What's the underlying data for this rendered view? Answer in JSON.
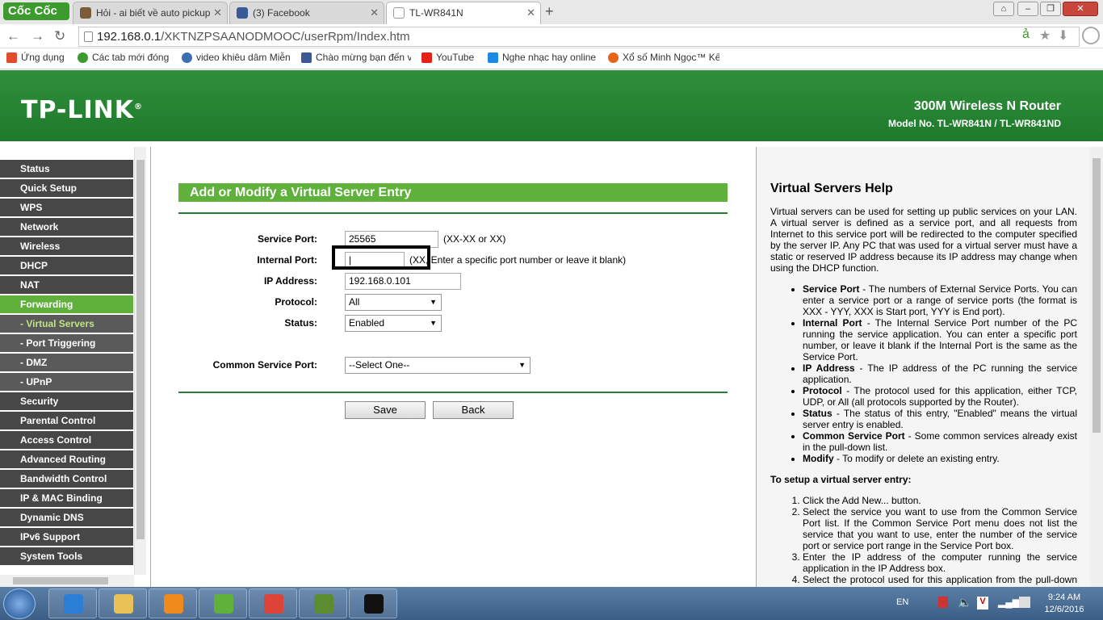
{
  "browser": {
    "logo": "Cốc Cốc",
    "tabs": [
      {
        "title": "Hỏi - ai biết về auto pickup",
        "color": "#7a5a3a"
      },
      {
        "title": "(3) Facebook",
        "color": "#3b5998"
      },
      {
        "title": "TL-WR841N",
        "color": "#ffffff"
      }
    ],
    "url_host": "192.168.0.1",
    "url_path": "/XKTNZPSAANODMOOC/userRpm/Index.htm",
    "bookmarks": [
      {
        "label": "Ứng dụng",
        "color": "#e24b2b"
      },
      {
        "label": "Các tab mới đóng",
        "color": "#3c9a2e"
      },
      {
        "label": "video khiêu dâm Miễn",
        "color": "#3a6fb0"
      },
      {
        "label": "Chào mừng bạn đến v",
        "color": "#3b5998"
      },
      {
        "label": "YouTube",
        "color": "#e62117"
      },
      {
        "label": "Nghe nhạc hay online",
        "color": "#1e88e5"
      },
      {
        "label": "Xổ số Minh Ngọc™ Kế",
        "color": "#e8641b"
      }
    ]
  },
  "router": {
    "brand": "TP-LINK",
    "trademark": "®",
    "title": "300M Wireless N Router",
    "model": "Model No. TL-WR841N / TL-WR841ND"
  },
  "menu": [
    {
      "label": "Status",
      "type": "main"
    },
    {
      "label": "Quick Setup",
      "type": "main"
    },
    {
      "label": "WPS",
      "type": "main"
    },
    {
      "label": "Network",
      "type": "main"
    },
    {
      "label": "Wireless",
      "type": "main"
    },
    {
      "label": "DHCP",
      "type": "main"
    },
    {
      "label": "NAT",
      "type": "main"
    },
    {
      "label": "Forwarding",
      "type": "active"
    },
    {
      "label": "- Virtual Servers",
      "type": "sub-selected"
    },
    {
      "label": "- Port Triggering",
      "type": "sub"
    },
    {
      "label": "- DMZ",
      "type": "sub"
    },
    {
      "label": "- UPnP",
      "type": "sub"
    },
    {
      "label": "Security",
      "type": "main"
    },
    {
      "label": "Parental Control",
      "type": "main"
    },
    {
      "label": "Access Control",
      "type": "main"
    },
    {
      "label": "Advanced Routing",
      "type": "main"
    },
    {
      "label": "Bandwidth Control",
      "type": "main"
    },
    {
      "label": "IP & MAC Binding",
      "type": "main"
    },
    {
      "label": "Dynamic DNS",
      "type": "main"
    },
    {
      "label": "IPv6 Support",
      "type": "main"
    },
    {
      "label": "System Tools",
      "type": "main"
    }
  ],
  "form": {
    "title": "Add or Modify a Virtual Server Entry",
    "service_port_label": "Service Port:",
    "service_port_value": "25565",
    "service_port_hint": "(XX-XX or XX)",
    "internal_port_label": "Internal Port:",
    "internal_port_value": "|",
    "internal_port_hint": "(XX, Enter a specific port number or leave it blank)",
    "ip_label": "IP Address:",
    "ip_value": "192.168.0.101",
    "protocol_label": "Protocol:",
    "protocol_value": "All",
    "status_label": "Status:",
    "status_value": "Enabled",
    "common_label": "Common Service Port:",
    "common_value": "--Select One--",
    "save": "Save",
    "back": "Back"
  },
  "help": {
    "title": "Virtual Servers Help",
    "intro": "Virtual servers can be used for setting up public services on your LAN. A virtual server is defined as a service port, and all requests from Internet to this service port will be redirected to the computer specified by the server IP. Any PC that was used for a virtual server must have a static or reserved IP address because its IP address may change when using the DHCP function.",
    "items": [
      {
        "term": "Service Port",
        "text": " - The numbers of External Service Ports. You can enter a service port or a range of service ports (the format is XXX - YYY, XXX is Start port, YYY is End port)."
      },
      {
        "term": "Internal Port",
        "text": " - The Internal Service Port number of the PC running the service application. You can enter a specific port number, or leave it blank if the Internal Port is the same as the Service Port."
      },
      {
        "term": "IP Address",
        "text": " - The IP address of the PC running the service application."
      },
      {
        "term": "Protocol",
        "text": " - The protocol used for this application, either TCP, UDP, or All (all protocols supported by the Router)."
      },
      {
        "term": "Status",
        "text": " - The status of this entry, \"Enabled\" means the virtual server entry is enabled."
      },
      {
        "term": "Common Service Port",
        "text": " - Some common services already exist in the pull-down list."
      },
      {
        "term": "Modify",
        "text": " - To modify or delete an existing entry."
      }
    ],
    "setup_title": "To setup a virtual server entry:",
    "steps": [
      "Click the Add New... button.",
      "Select the service you want to use from the Common Service Port list. If the Common Service Port menu does not list the service that you want to use, enter the number of the service port or service port range in the Service Port box.",
      "Enter the IP address of the computer running the service application in the IP Address box.",
      "Select the protocol used for this application from the pull-down list, either TCP, UDP, or All."
    ]
  },
  "taskbar": {
    "apps": [
      {
        "name": "ie-icon",
        "color": "#2a7fd4"
      },
      {
        "name": "explorer-icon",
        "color": "#e8c257"
      },
      {
        "name": "media-player-icon",
        "color": "#f08a1c"
      },
      {
        "name": "coccoc-icon",
        "color": "#5fb13c"
      },
      {
        "name": "chrome-icon",
        "color": "#db4437"
      },
      {
        "name": "minecraft-icon",
        "color": "#5b8c32"
      },
      {
        "name": "cmd-icon",
        "color": "#111111"
      }
    ],
    "lang": "EN",
    "time": "9:24 AM",
    "date": "12/6/2016"
  }
}
